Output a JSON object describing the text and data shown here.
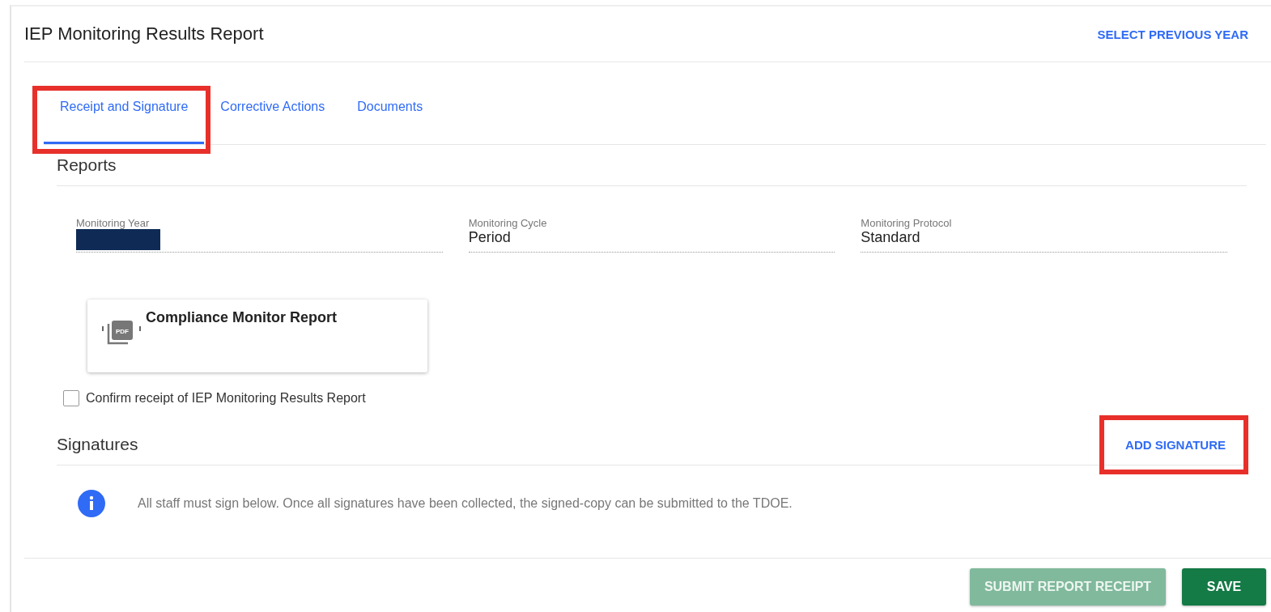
{
  "header": {
    "title": "IEP Monitoring Results Report",
    "action": "SELECT PREVIOUS YEAR"
  },
  "tabs": [
    {
      "label": "Receipt and Signature",
      "selected": true,
      "annotated": true
    },
    {
      "label": "Corrective Actions",
      "selected": false,
      "annotated": false
    },
    {
      "label": "Documents",
      "selected": false,
      "annotated": false
    }
  ],
  "reports": {
    "heading": "Reports",
    "fields": [
      {
        "label": "Monitoring Year",
        "redacted": true
      },
      {
        "label": "Monitoring Cycle",
        "value": "Period",
        "redacted": false
      },
      {
        "label": "Monitoring Protocol",
        "value": "Standard",
        "redacted": false
      }
    ],
    "document": {
      "title": "Compliance Monitor Report",
      "icon_text": "PDF"
    },
    "confirm": {
      "label": "Confirm receipt of IEP Monitoring Results Report",
      "checked": false
    }
  },
  "signatures": {
    "heading": "Signatures",
    "action": {
      "label": "ADD SIGNATURE",
      "annotated": true
    },
    "info": "All staff must sign below. Once all signatures have been collected, the signed-copy can be submitted to the TDOE."
  },
  "footer": {
    "buttons": [
      {
        "label": "SUBMIT REPORT RECEIPT",
        "kind": "secondary",
        "disabled": true
      },
      {
        "label": "SAVE",
        "kind": "primary",
        "disabled": false
      }
    ]
  }
}
